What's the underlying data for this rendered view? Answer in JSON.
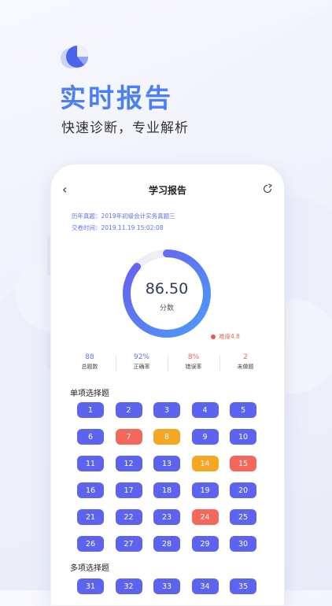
{
  "hero": {
    "title": "实时报告",
    "subtitle": "快速诊断，专业解析"
  },
  "nav": {
    "back_label": "‹",
    "title": "学习报告"
  },
  "exam": {
    "name_line": "历年真题：2019年初级会计实务真题三",
    "time_line": "交卷时间：2019.11.19  15:02:08"
  },
  "result": {
    "score": "86.50",
    "score_label": "分数",
    "score_fraction": 0.865,
    "difficulty": "难度4.8"
  },
  "stats": [
    {
      "value": "88",
      "label": "总题数",
      "color": "#5b72e8"
    },
    {
      "value": "92%",
      "label": "正确率",
      "color": "#5b72e8"
    },
    {
      "value": "8%",
      "label": "错误率",
      "color": "#e8675c"
    },
    {
      "value": "2",
      "label": "未做题",
      "color": "#e8675c"
    }
  ],
  "sections": [
    {
      "title": "单项选择题",
      "items": [
        {
          "n": "1",
          "s": "correct"
        },
        {
          "n": "2",
          "s": "correct"
        },
        {
          "n": "3",
          "s": "correct"
        },
        {
          "n": "4",
          "s": "correct"
        },
        {
          "n": "5",
          "s": "correct"
        },
        {
          "n": "6",
          "s": "correct"
        },
        {
          "n": "7",
          "s": "wrong"
        },
        {
          "n": "8",
          "s": "undone"
        },
        {
          "n": "9",
          "s": "correct"
        },
        {
          "n": "10",
          "s": "correct"
        },
        {
          "n": "11",
          "s": "correct"
        },
        {
          "n": "12",
          "s": "correct"
        },
        {
          "n": "13",
          "s": "correct"
        },
        {
          "n": "14",
          "s": "undone"
        },
        {
          "n": "15",
          "s": "wrong"
        },
        {
          "n": "16",
          "s": "correct"
        },
        {
          "n": "17",
          "s": "correct"
        },
        {
          "n": "18",
          "s": "correct"
        },
        {
          "n": "19",
          "s": "correct"
        },
        {
          "n": "20",
          "s": "correct"
        },
        {
          "n": "21",
          "s": "correct"
        },
        {
          "n": "22",
          "s": "correct"
        },
        {
          "n": "23",
          "s": "correct"
        },
        {
          "n": "24",
          "s": "wrong"
        },
        {
          "n": "25",
          "s": "correct"
        },
        {
          "n": "26",
          "s": "correct"
        },
        {
          "n": "27",
          "s": "correct"
        },
        {
          "n": "28",
          "s": "correct"
        },
        {
          "n": "29",
          "s": "correct"
        },
        {
          "n": "30",
          "s": "correct"
        }
      ]
    },
    {
      "title": "多项选择题",
      "items": [
        {
          "n": "31",
          "s": "correct"
        },
        {
          "n": "32",
          "s": "correct"
        },
        {
          "n": "33",
          "s": "correct"
        },
        {
          "n": "34",
          "s": "correct"
        },
        {
          "n": "35",
          "s": "correct"
        }
      ]
    }
  ],
  "colors": {
    "accent": "#5c63ee",
    "wrong": "#f4675b",
    "undone": "#f5a623",
    "ring_start": "#4b9cf8",
    "ring_end": "#6a5cf0"
  },
  "icons": {
    "logo": "pie-chart-icon",
    "back": "chevron-left-icon",
    "share": "refresh-share-icon"
  }
}
